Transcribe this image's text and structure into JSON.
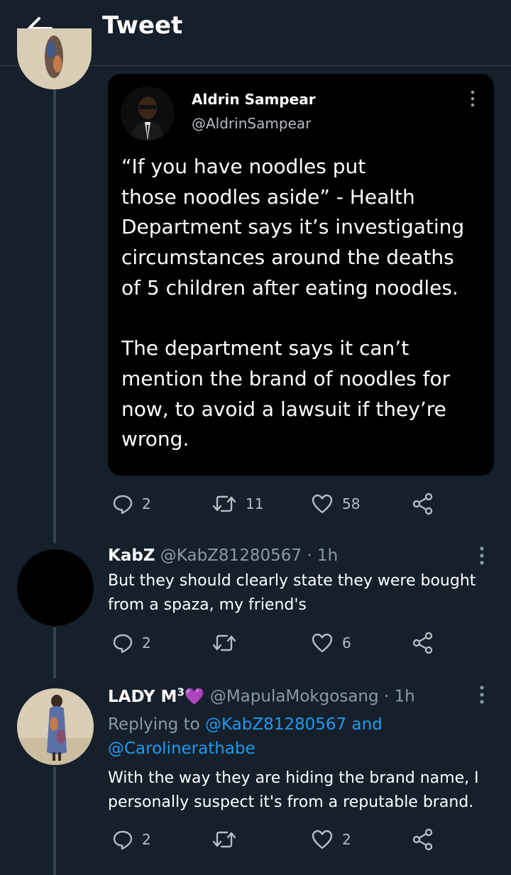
{
  "header": {
    "title": "Tweet"
  },
  "quoted": {
    "name": "Aldrin Sampear",
    "handle": "@AldrinSampear",
    "text": "“If you have noodles put\nthose noodles aside” - Health\nDepartment says it’s investigating\ncircumstances around the deaths\nof 5 children after eating noodles.\n\nThe department says it can’t\nmention the brand of noodles for\nnow, to avoid a lawsuit if they’re\nwrong."
  },
  "main_actions": {
    "replies": "2",
    "retweets": "11",
    "likes": "58"
  },
  "replies": [
    {
      "name": "KabZ",
      "handle": "@KabZ81280567",
      "time": "· 1h",
      "text_line1": "But they should clearly state they were bought",
      "text_line2": "from a spaza, my friend's",
      "reply_count": "2",
      "retweet_count": "",
      "like_count": "6"
    },
    {
      "name": "LADY M",
      "name_sup": "3",
      "emoji": "💜",
      "handle": "@MapulaMokgosang",
      "time": "· 1h",
      "replying_prefix": "Replying to",
      "replying_user1": "@KabZ81280567",
      "replying_and": "and",
      "replying_user2": "@Carolinerathabe",
      "text_line1": "With the way they are hiding the brand name, I",
      "text_line2": "personally suspect it's from a reputable brand.",
      "reply_count": "2",
      "retweet_count": "",
      "like_count": "2"
    }
  ],
  "icons": {
    "back": "arrow-left-icon",
    "reply": "speech-bubble-icon",
    "retweet": "retweet-icon",
    "like": "heart-icon",
    "share": "share-icon",
    "more": "vertical-dots-icon"
  },
  "colors": {
    "background": "#15202b",
    "card": "#000000",
    "muted": "#8b98a5",
    "link": "#1d9bf0"
  }
}
